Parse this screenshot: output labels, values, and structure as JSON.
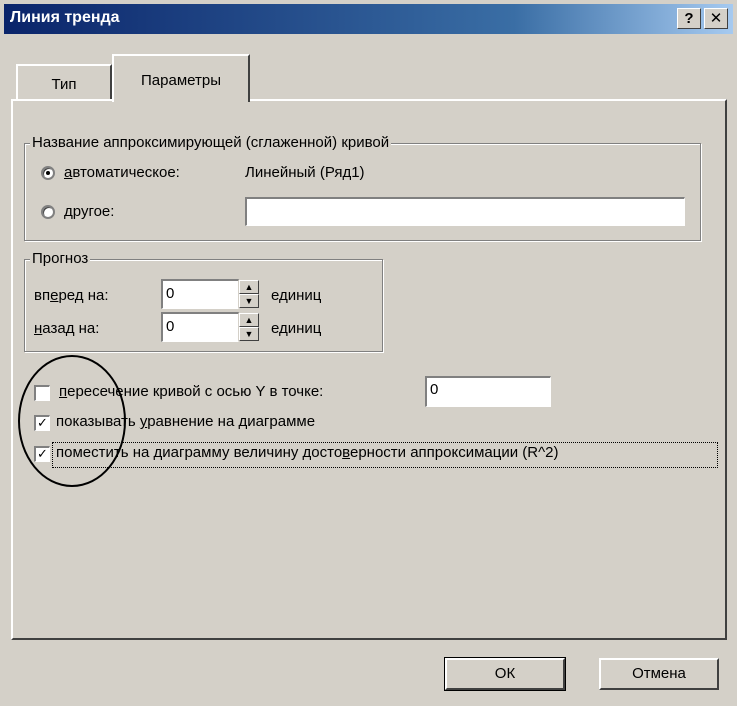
{
  "window": {
    "title": "Линия тренда",
    "help_label": "?",
    "close_label": "✕"
  },
  "tabs": [
    {
      "label": "Тип",
      "active": false
    },
    {
      "label": "Параметры",
      "active": true
    }
  ],
  "name_group": {
    "legend": "Название аппроксимирующей (сглаженной) кривой",
    "auto_option": {
      "label_u": "а",
      "label_rest": "втоматическое:",
      "selected": true,
      "value": "Линейный (Ряд1)"
    },
    "other_option": {
      "label_u": "д",
      "label_rest": "ругое:",
      "selected": false,
      "value": ""
    }
  },
  "forecast_group": {
    "legend": "Прогноз",
    "forward": {
      "label_pre": "вп",
      "label_u": "е",
      "label_post": "ред на:",
      "value": "0",
      "unit": "единиц"
    },
    "backward": {
      "label_pre": "",
      "label_u": "н",
      "label_post": "азад на:",
      "value": "0",
      "unit": "единиц"
    }
  },
  "options": {
    "intercept": {
      "label_u": "п",
      "label_rest": "ересечение кривой с осью Y в точке:",
      "checked": false,
      "value": "0"
    },
    "show_equation": {
      "label_pre": "показывать ",
      "label_u": "у",
      "label_post": "равнение на диаграмме",
      "checked": true,
      "mark": "✓"
    },
    "show_r2": {
      "label_pre": "поместить на диаграмму величину досто",
      "label_u": "в",
      "label_post": "ерности аппроксимации (R^2)",
      "checked": true,
      "mark": "✓"
    }
  },
  "buttons": {
    "ok": "ОК",
    "cancel": "Отмена"
  }
}
